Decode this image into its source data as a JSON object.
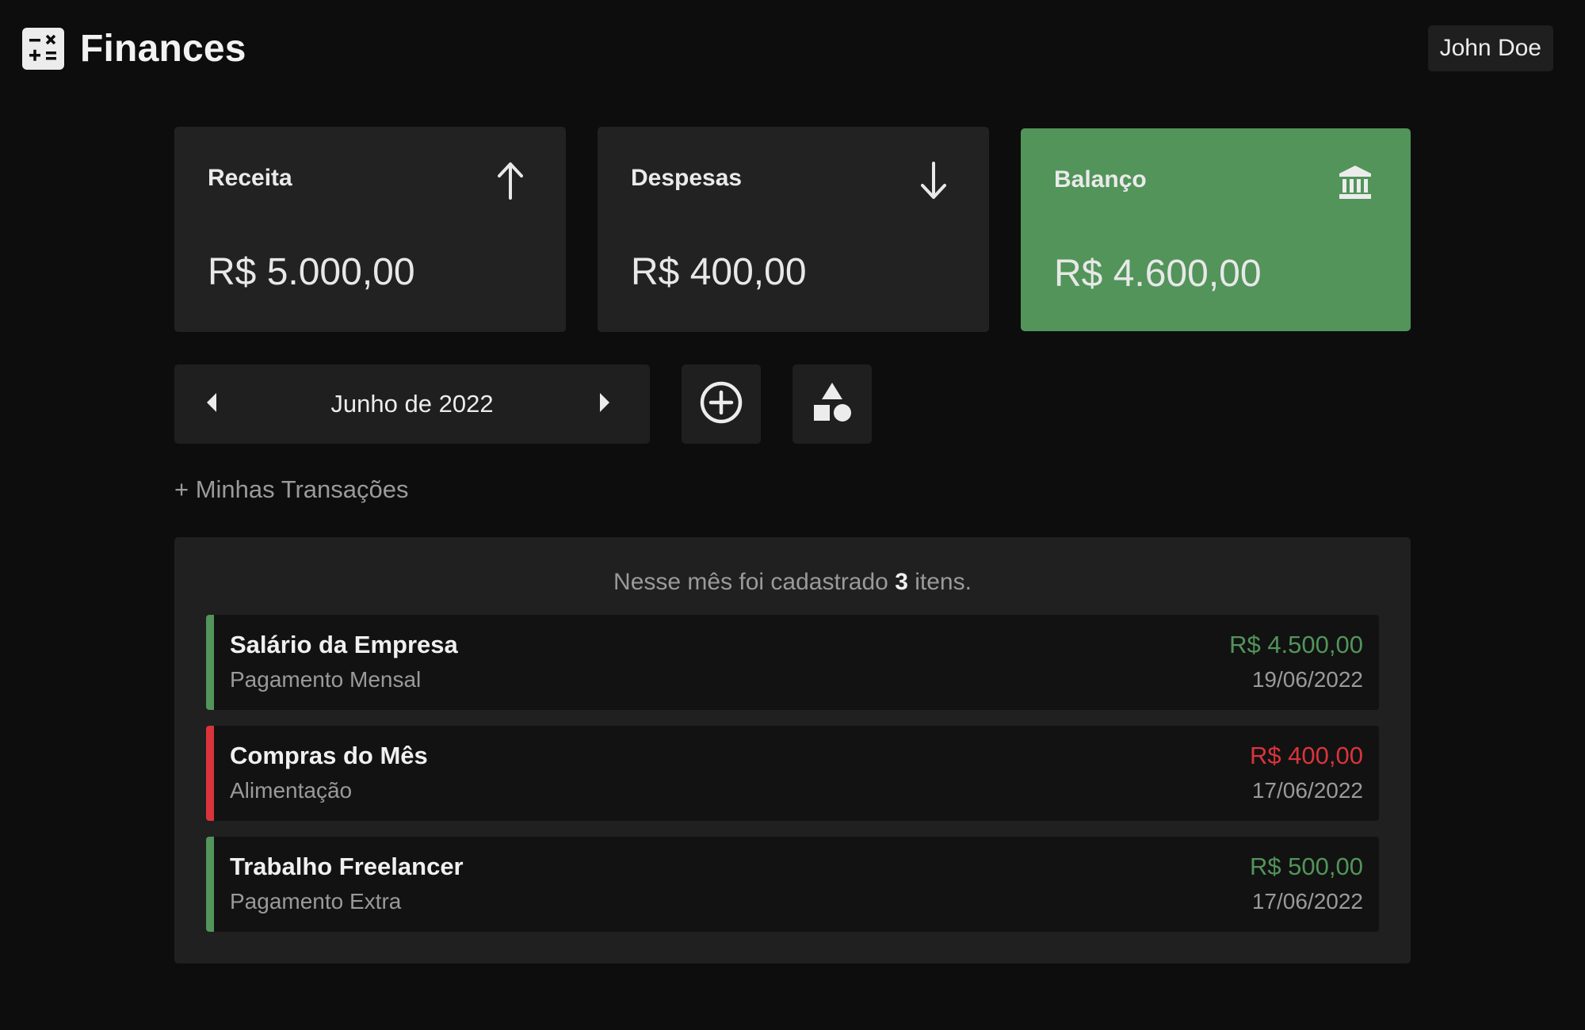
{
  "app": {
    "title": "Finances",
    "icon": "calculator-icon"
  },
  "user": {
    "name": "John Doe"
  },
  "colors": {
    "background": "#0d0d0d",
    "card": "#222222",
    "balance_card": "#52945a",
    "income": "#52945a",
    "expense": "#d9343b",
    "muted": "#9a9a9a"
  },
  "summary": {
    "income": {
      "label": "Receita",
      "value": "R$ 5.000,00",
      "icon": "arrow-up-icon"
    },
    "expenses": {
      "label": "Despesas",
      "value": "R$ 400,00",
      "icon": "arrow-down-icon"
    },
    "balance": {
      "label": "Balanço",
      "value": "R$ 4.600,00",
      "icon": "bank-icon"
    }
  },
  "month_nav": {
    "label": "Junho de 2022",
    "prev_icon": "caret-left-icon",
    "next_icon": "caret-right-icon"
  },
  "actions": {
    "add_icon": "plus-circle-icon",
    "categories_icon": "shapes-icon"
  },
  "transactions_section": {
    "label": "+ Minhas Transações"
  },
  "transactions_panel": {
    "summary_prefix": "Nesse mês foi cadastrado",
    "count": "3",
    "summary_suffix": "itens.",
    "items": [
      {
        "title": "Salário da Empresa",
        "category": "Pagamento Mensal",
        "amount": "R$ 4.500,00",
        "date": "19/06/2022",
        "type": "income"
      },
      {
        "title": "Compras do Mês",
        "category": "Alimentação",
        "amount": "R$ 400,00",
        "date": "17/06/2022",
        "type": "expense"
      },
      {
        "title": "Trabalho Freelancer",
        "category": "Pagamento Extra",
        "amount": "R$ 500,00",
        "date": "17/06/2022",
        "type": "income"
      }
    ]
  }
}
